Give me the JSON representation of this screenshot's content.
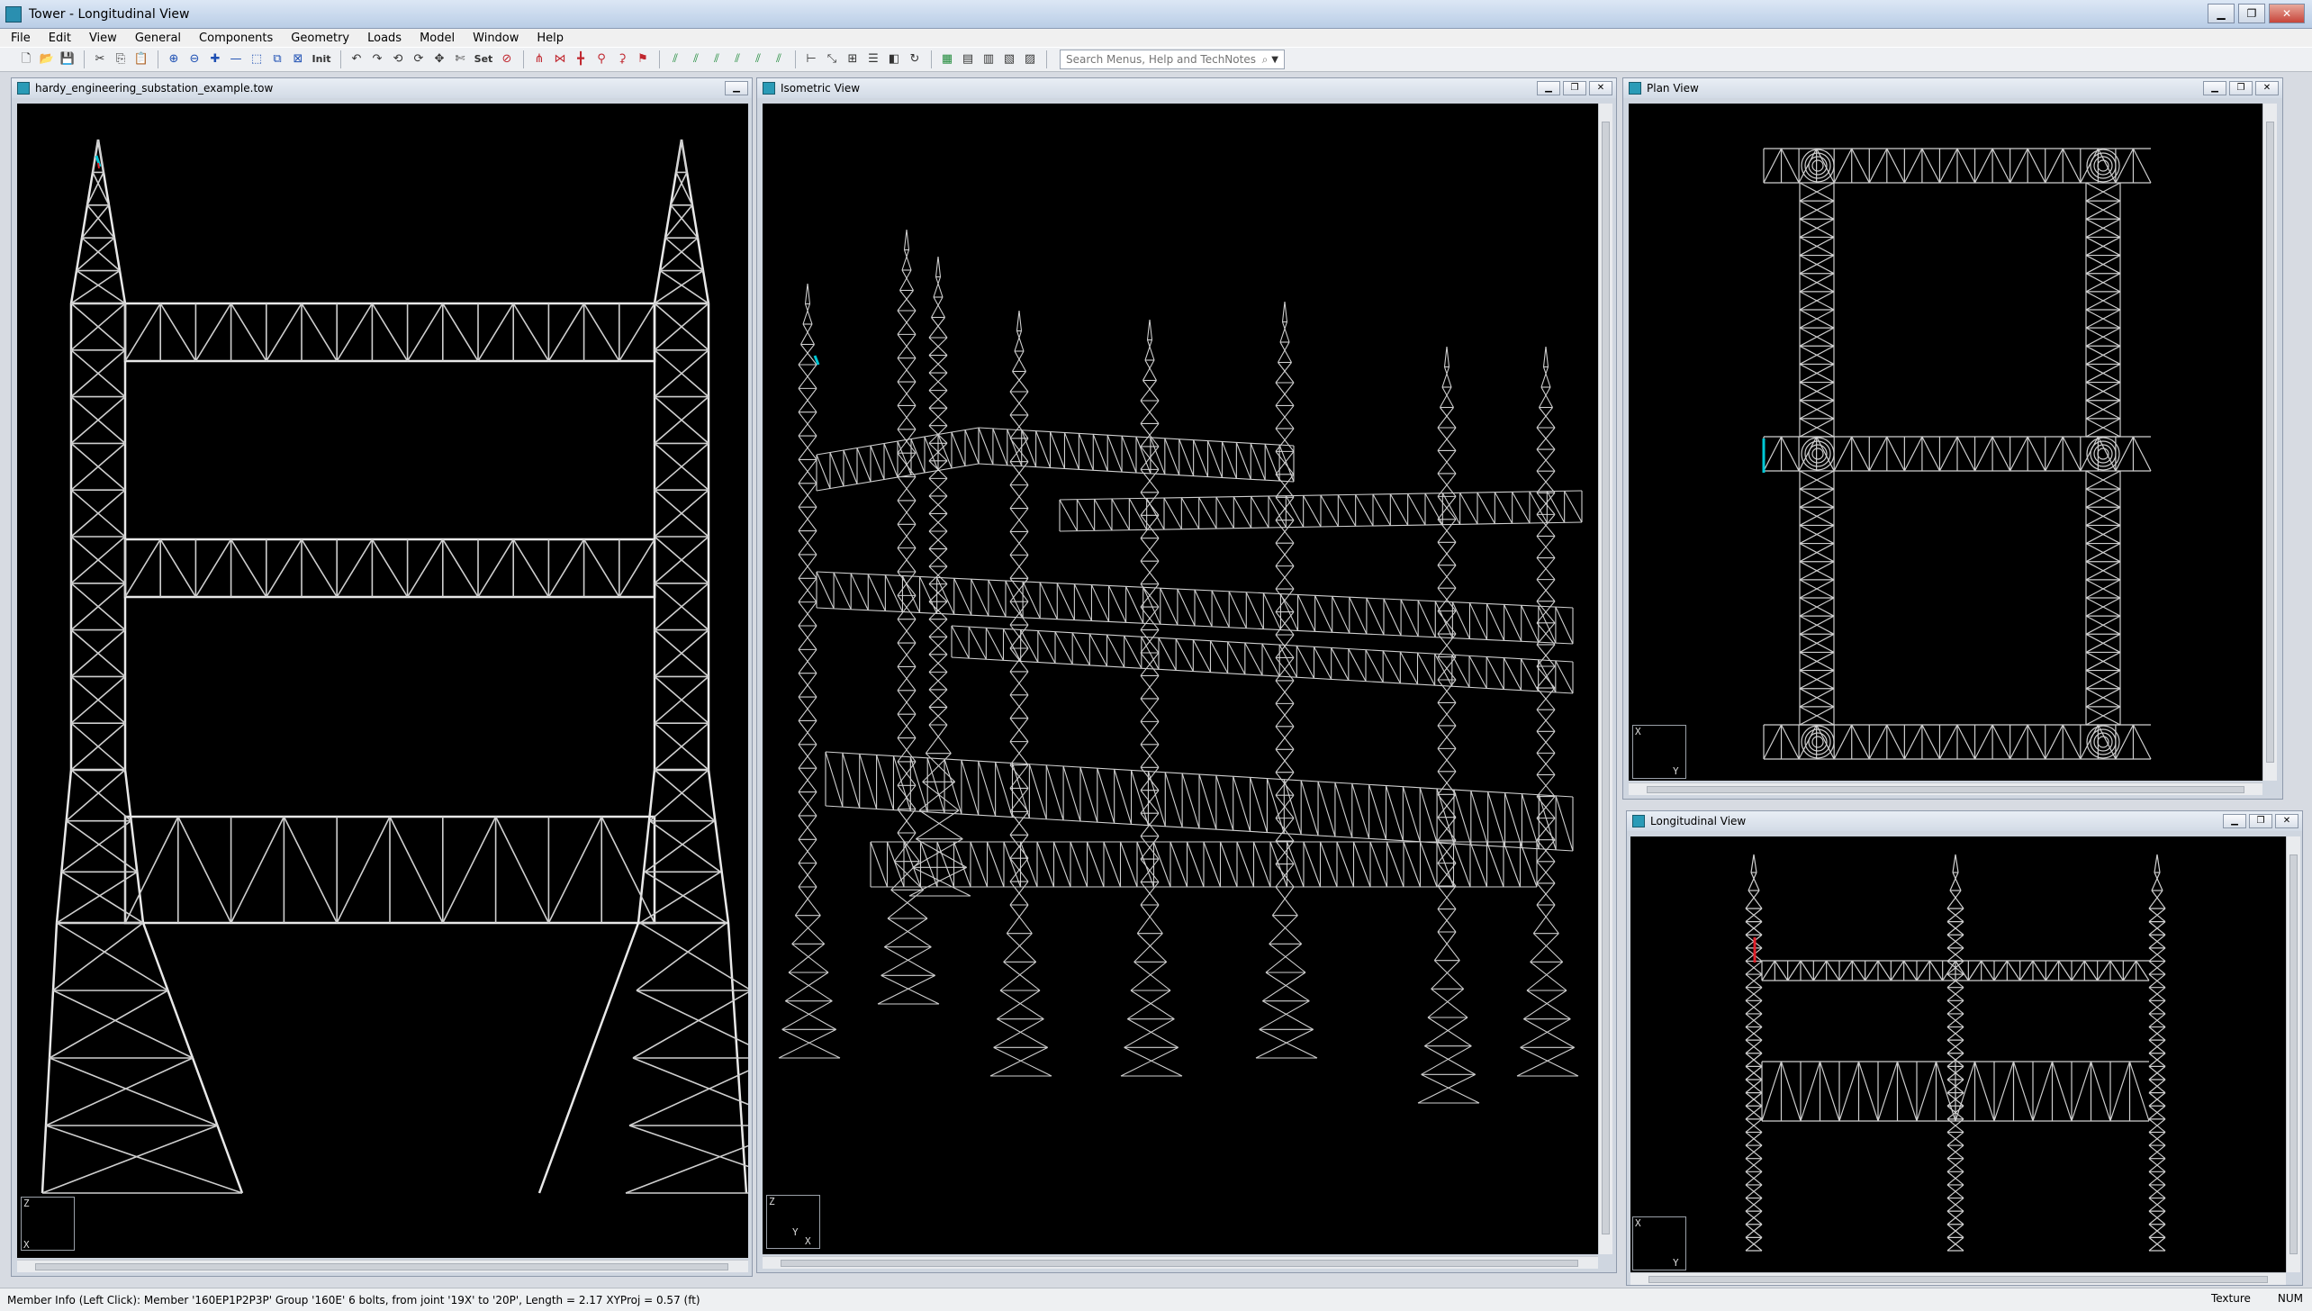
{
  "app": {
    "title": "Tower - Longitudinal View"
  },
  "menu": [
    "File",
    "Edit",
    "View",
    "General",
    "Components",
    "Geometry",
    "Loads",
    "Model",
    "Window",
    "Help"
  ],
  "toolbar": {
    "init_label": "Init",
    "set_label": "Set",
    "search_placeholder": "Search Menus, Help and TechNotes"
  },
  "windows": {
    "left": {
      "title": "hardy_engineering_substation_example.tow"
    },
    "iso": {
      "title": "Isometric View"
    },
    "plan": {
      "title": "Plan View"
    },
    "longitudinal": {
      "title": "Longitudinal View"
    }
  },
  "axes": {
    "left": {
      "v": "Z",
      "h": "X"
    },
    "iso": {
      "v": "Z",
      "h1": "Y",
      "h2": "X"
    },
    "plan": {
      "v": "X",
      "h": "Y"
    },
    "longitudinal": {
      "v": "X",
      "h": "Y"
    }
  },
  "status": {
    "message": "Member Info (Left Click): Member '160EP1P2P3P' Group '160E' 6 bolts, from joint '19X' to '20P', Length = 2.17 XYProj = 0.57 (ft)",
    "texture": "Texture",
    "num": "NUM"
  },
  "colors": {
    "viewport_bg": "#000000",
    "member": "#e8e8e8",
    "highlight": "#00c8d6",
    "selected": "#e0202a"
  }
}
